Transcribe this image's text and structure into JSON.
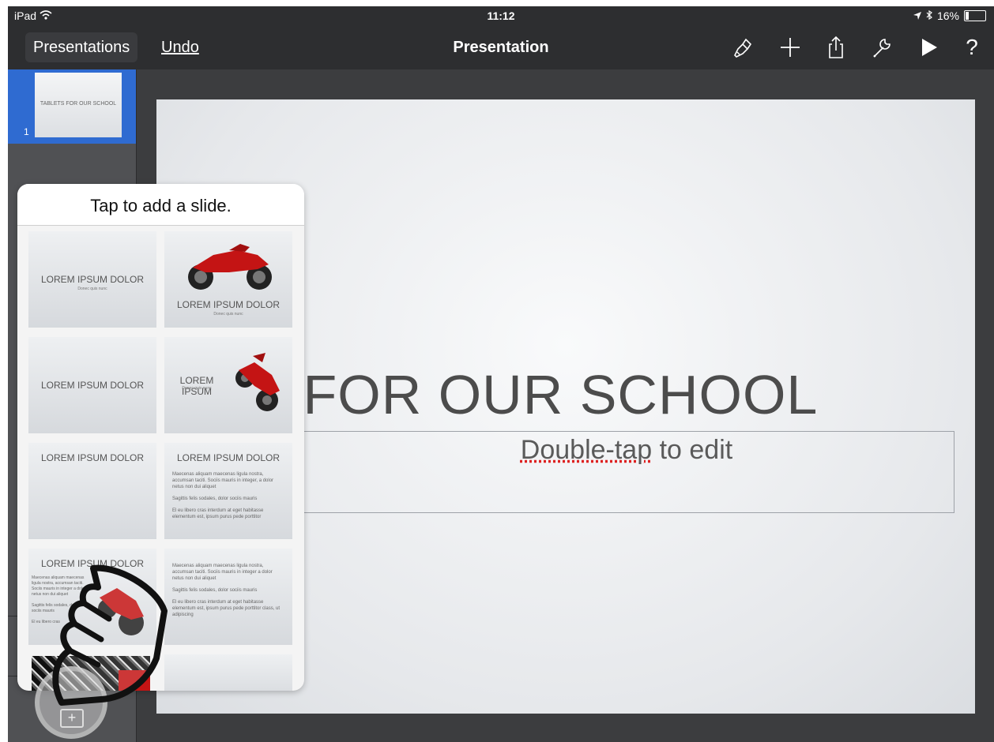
{
  "status_bar": {
    "device": "iPad",
    "time": "11:12",
    "battery": "16%",
    "battery_level": 0.16
  },
  "toolbar": {
    "presentations_label": "Presentations",
    "undo_label": "Undo",
    "title": "Presentation",
    "tools": [
      "paintbrush-icon",
      "plus-icon",
      "share-icon",
      "wrench-icon",
      "play-icon",
      "help-icon"
    ],
    "help_glyph": "?"
  },
  "navigator": {
    "slides": [
      {
        "number": "1",
        "thumbnail_text": "TABLETS FOR OUR SCHOOL",
        "selected": true
      }
    ]
  },
  "canvas": {
    "title": "LETS FOR OUR SCHOOL",
    "subtitle_underlined": "Double-tap",
    "subtitle_rest": " to edit"
  },
  "popover": {
    "title": "Tap to add a slide.",
    "layouts": [
      {
        "title": "LOREM IPSUM DOLOR",
        "subtitle": "Donec quis nunc"
      },
      {
        "title": "LOREM IPSUM DOLOR",
        "subtitle": "Donec quis nunc"
      },
      {
        "title": "LOREM IPSUM DOLOR"
      },
      {
        "title": "LOREM IPSUM",
        "subtitle": "Donec quis nunc"
      },
      {
        "title": "LOREM IPSUM DOLOR"
      },
      {
        "title": "LOREM IPSUM DOLOR",
        "bullets": [
          "Maecenas aliquam maecenas ligula nostra, accumsan taciti. Sociis mauris in integer, a dolor netus non dui aliquet",
          "Sagittis felis sodales, dolor sociis mauris",
          "El eu libero cras interdum at eget habitasse elementum est, ipsum purus pede porttitor"
        ]
      },
      {
        "title": "LOREM IPSUM DOLOR",
        "bullets": [
          "Maecenas aliquam maecenas ligula nostra, accumsan taciti. Sociis mauris in integer a dolor netus non dui aliquet",
          "Sagittis felis sodales, dolor sociis mauris",
          "El eu libero cras"
        ]
      },
      {
        "bullets": [
          "Maecenas aliquam maecenas ligula nostra, accumsan taciti. Sociis mauris in integer a dolor netus non dui aliquet",
          "Sagittis felis sodales, dolor sociis mauris",
          "El eu libero cras interdum at eget habitasse elementum est, ipsum purus pede porttitor class, ut adipiscing"
        ]
      }
    ]
  },
  "add_slide_icon": "plus-icon",
  "colors": {
    "toolbar_bg": "#2d2e30",
    "selection_blue": "#2f6bd1",
    "bike_red": "#c41414"
  }
}
